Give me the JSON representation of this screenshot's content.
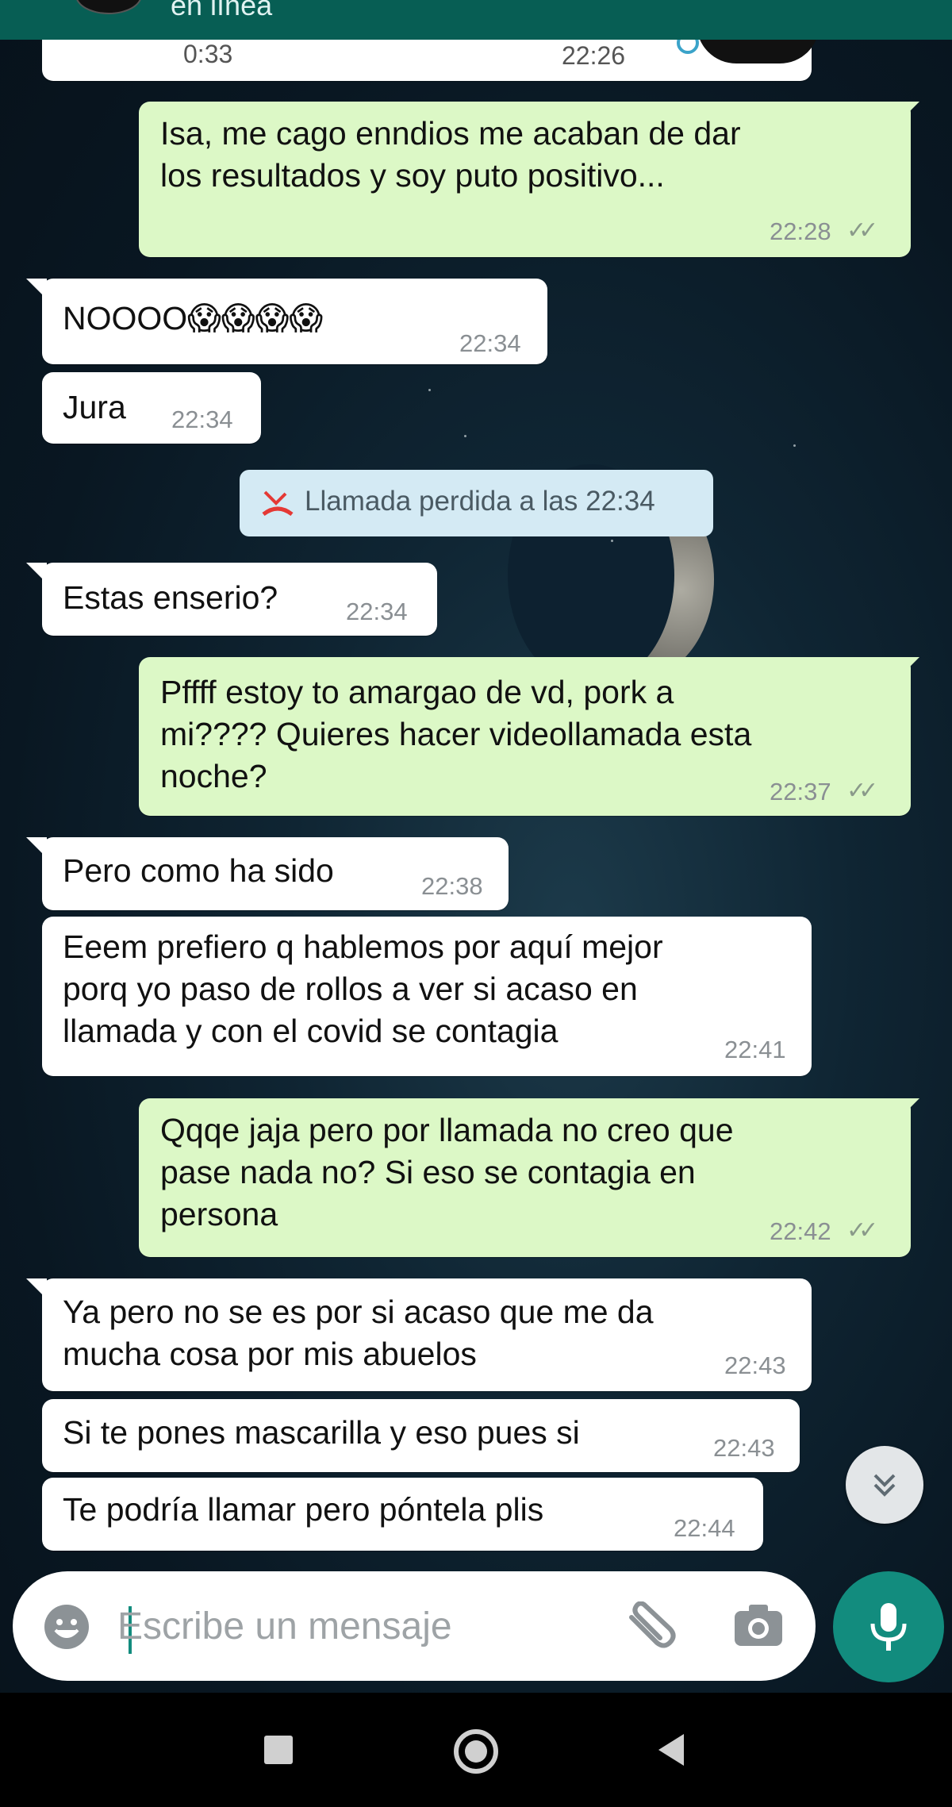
{
  "header": {
    "status": "en línea"
  },
  "colors": {
    "header": "#075e54",
    "outgoing": "#dcf8c6",
    "incoming": "#ffffff",
    "accent": "#128c7e"
  },
  "top_partial": {
    "duration": "0:33",
    "time": "22:26"
  },
  "messages": [
    {
      "dir": "out",
      "text": "Isa, me cago enndios me acaban de dar\nlos resultados y soy puto positivo...",
      "time": "22:28",
      "status": "read"
    },
    {
      "dir": "in",
      "text": "NOOOO😱😱😱😱",
      "time": "22:34"
    },
    {
      "dir": "in",
      "text": "Jura",
      "time": "22:34"
    },
    {
      "dir": "in",
      "text": "Estas enserio?",
      "time": "22:34"
    },
    {
      "dir": "out",
      "text": "Pffff estoy to amargao de vd, pork a\nmi???? Quieres hacer videollamada esta\nnoche?",
      "time": "22:37",
      "status": "read"
    },
    {
      "dir": "in",
      "text": "Pero como ha sido",
      "time": "22:38"
    },
    {
      "dir": "in",
      "text": "Eeem prefiero q hablemos por aquí mejor\nporq yo paso de rollos a ver si acaso en\nllamada y con el covid se contagia",
      "time": "22:41"
    },
    {
      "dir": "out",
      "text": "Qqqe jaja pero por llamada no creo que\npase nada no? Si eso se contagia en\npersona",
      "time": "22:42",
      "status": "read"
    },
    {
      "dir": "in",
      "text": "Ya pero no se es por si acaso que me da\nmucha cosa por mis abuelos",
      "time": "22:43"
    },
    {
      "dir": "in",
      "text": "Si te pones mascarilla y eso pues si",
      "time": "22:43"
    },
    {
      "dir": "in",
      "text": "Te podría llamar pero póntela plis",
      "time": "22:44"
    }
  ],
  "system_message": {
    "text": "Llamada perdida a las 22:34",
    "icon": "missed-call-icon"
  },
  "composer": {
    "placeholder": "Escribe un mensaje"
  },
  "icons": {
    "emoji": "emoji-icon",
    "attach": "paperclip-icon",
    "camera": "camera-icon",
    "mic": "mic-icon",
    "scroll": "chevron-double-down-icon",
    "nav": [
      "square-icon",
      "circle-icon",
      "triangle-back-icon"
    ]
  }
}
